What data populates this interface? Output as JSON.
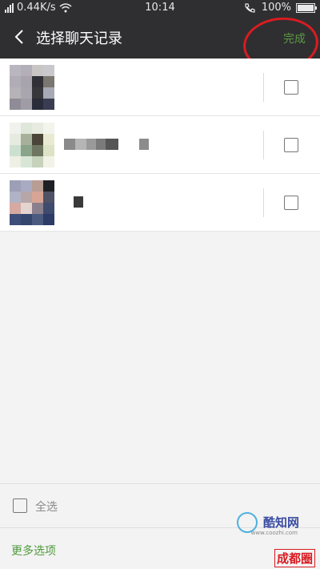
{
  "status_bar": {
    "network_speed": "0.44K/s",
    "time": "10:14",
    "battery": "100%"
  },
  "header": {
    "title": "选择聊天记录",
    "done_label": "完成"
  },
  "footer": {
    "select_all_label": "全选",
    "more_options_label": "更多选项"
  },
  "watermark": {
    "site_name": "酷知网",
    "site_url": "www.coozhi.com",
    "site_name_2": "成都圈"
  },
  "colors": {
    "header_bg": "#2f2f31",
    "accent_green": "#4e9a3b",
    "annotation_red": "#d81c22"
  }
}
